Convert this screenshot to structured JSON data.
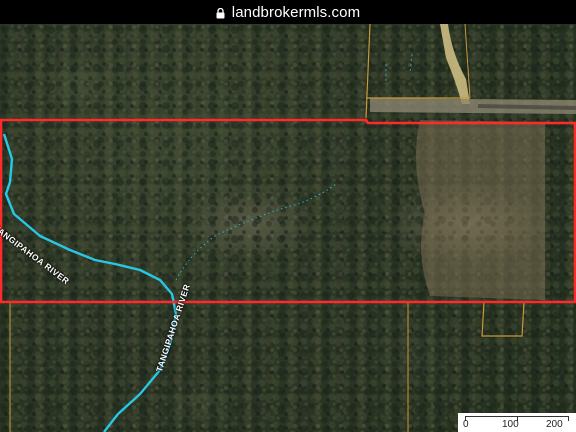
{
  "browser": {
    "url": "landbrokermls.com",
    "lock_icon": "lock-icon"
  },
  "map": {
    "river_label_1": "TANGIPAHOA RIVER",
    "river_label_2": "TANGIPAHOA RIVER",
    "parcel_outline_color": "#ff2a2a",
    "river_color": "#29c7e6",
    "boundary_line_color": "#c89a3a",
    "road_color": "#d6c487"
  },
  "scale": {
    "label_0": "0",
    "label_100": "100",
    "label_200": "200"
  }
}
